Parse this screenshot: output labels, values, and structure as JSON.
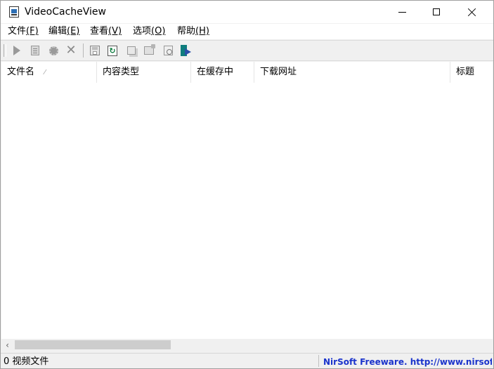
{
  "window": {
    "title": "VideoCacheView",
    "app_icon": "videocacheview-app-icon"
  },
  "menu": [
    {
      "label": "文件",
      "accel": "(F)"
    },
    {
      "label": "编辑",
      "accel": "(E)"
    },
    {
      "label": "查看",
      "accel": "(V)"
    },
    {
      "label": "选项",
      "accel": "(O)"
    },
    {
      "label": "帮助",
      "accel": "(H)"
    }
  ],
  "toolbar": {
    "icons": [
      "play-icon",
      "copy-file-icon",
      "gear-icon",
      "delete-x-icon",
      "save-icon",
      "refresh-icon",
      "copy-icon",
      "properties-icon",
      "find-icon",
      "exit-icon"
    ],
    "delete_glyph": "✕",
    "refresh_glyph": "↻"
  },
  "list": {
    "columns": [
      "文件名",
      "内容类型",
      "在缓存中",
      "下载网址",
      "标题"
    ],
    "sort_indicator": "⁄",
    "rows": []
  },
  "scrollbar": {
    "left_arrow": "‹"
  },
  "status": {
    "count_text": "0 视频文件",
    "link_text": "NirSoft Freeware.  http://www.nirsoft.net"
  },
  "colors": {
    "link": "#1a33cc",
    "chrome": "#f0f0f0",
    "list_bg": "#ffffff"
  }
}
